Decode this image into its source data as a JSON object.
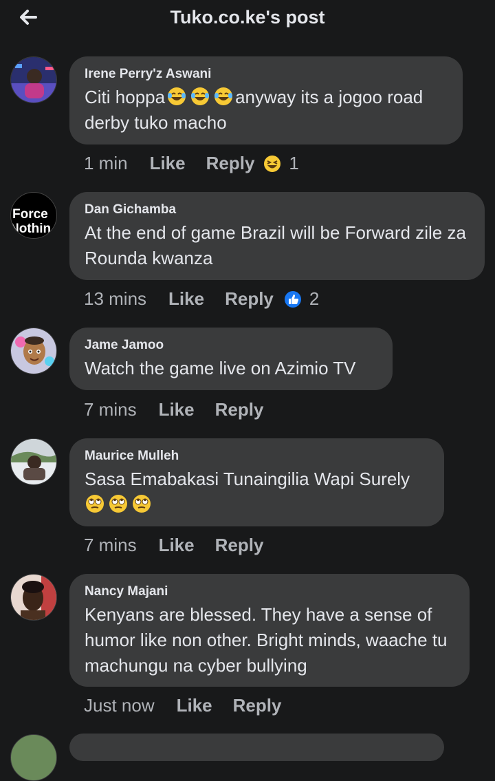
{
  "header": {
    "title": "Tuko.co.ke's post",
    "back_icon": "arrow-left-icon"
  },
  "comments": [
    {
      "author": "Irene Perry'z Aswani",
      "text_prefix": "Citi hoppa",
      "text_suffix": "anyway its a jogoo road derby tuko macho",
      "inline_emoji": "laughing-tears-emoji",
      "time": "1 min",
      "like": "Like",
      "reply": "Reply",
      "reaction": "haha-reaction-icon",
      "reaction_count": "1"
    },
    {
      "author": "Dan Gichamba",
      "avatar_text_line1": "Force",
      "avatar_text_line2": "Nothin",
      "text": "At the end of game Brazil will be Forward zile za Rounda kwanza",
      "time": "13 mins",
      "like": "Like",
      "reply": "Reply",
      "reaction": "like-reaction-icon",
      "reaction_count": "2"
    },
    {
      "author": "Jame Jamoo",
      "text": "Watch the game live on Azimio TV",
      "time": "7 mins",
      "like": "Like",
      "reply": "Reply"
    },
    {
      "author": "Maurice Mulleh",
      "text": "Sasa Emabakasi Tunaingilia Wapi Surely",
      "inline_emoji": "eye-roll-emoji",
      "time": "7 mins",
      "like": "Like",
      "reply": "Reply"
    },
    {
      "author": "Nancy Majani",
      "text": "Kenyans are blessed. They have a sense of humor like non other. Bright minds, waache tu machungu na cyber bullying",
      "time": "Just now",
      "like": "Like",
      "reply": "Reply"
    }
  ],
  "colors": {
    "background": "#18191a",
    "bubble": "#3a3b3c",
    "text": "#e4e6eb",
    "muted": "#b0b3b8",
    "like_blue": "#1877f2",
    "emoji_yellow": "#f7c935"
  }
}
